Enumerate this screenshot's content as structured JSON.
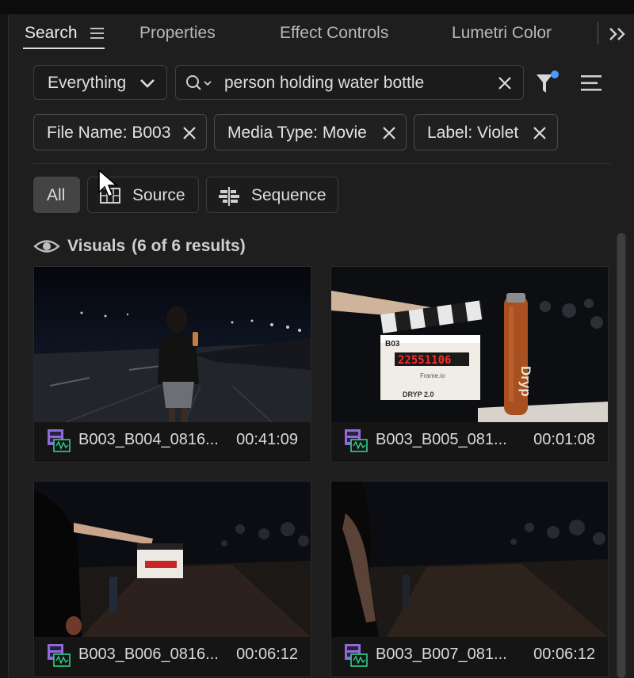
{
  "tabs": [
    {
      "label": "Search",
      "active": true
    },
    {
      "label": "Properties"
    },
    {
      "label": "Effect Controls"
    },
    {
      "label": "Lumetri Color"
    }
  ],
  "search": {
    "scope": "Everything",
    "query": "person holding water bottle"
  },
  "filters": [
    {
      "label": "File Name: B003"
    },
    {
      "label": "Media Type: Movie"
    },
    {
      "label": "Label: Violet"
    }
  ],
  "segments": [
    {
      "label": "All",
      "selected": true
    },
    {
      "label": "Source",
      "icon": "source-monitor-icon"
    },
    {
      "label": "Sequence",
      "icon": "sequence-icon"
    }
  ],
  "results": {
    "heading": "Visuals",
    "count": "(6 of 6 results)"
  },
  "clips": [
    {
      "name": "B003_B004_0816...",
      "duration": "00:41:09"
    },
    {
      "name": "B003_B005_081...",
      "duration": "00:01:08"
    },
    {
      "name": "B003_B006_0816...",
      "duration": "00:06:12"
    },
    {
      "name": "B003_B007_081...",
      "duration": "00:06:12"
    }
  ],
  "slate_text": {
    "roll": "B03",
    "timecode": "22551106",
    "brand": "Frame.io",
    "title": "DRYP 2.0"
  },
  "bottle_label": "Dryp",
  "colors": {
    "panel_bg": "#1e1e1e",
    "accent_dot": "#4a9cff",
    "clip_icon_violet": "#8e6ad8",
    "clip_icon_green": "#2fd08a",
    "slate_timecode": "#ff2b2b"
  }
}
